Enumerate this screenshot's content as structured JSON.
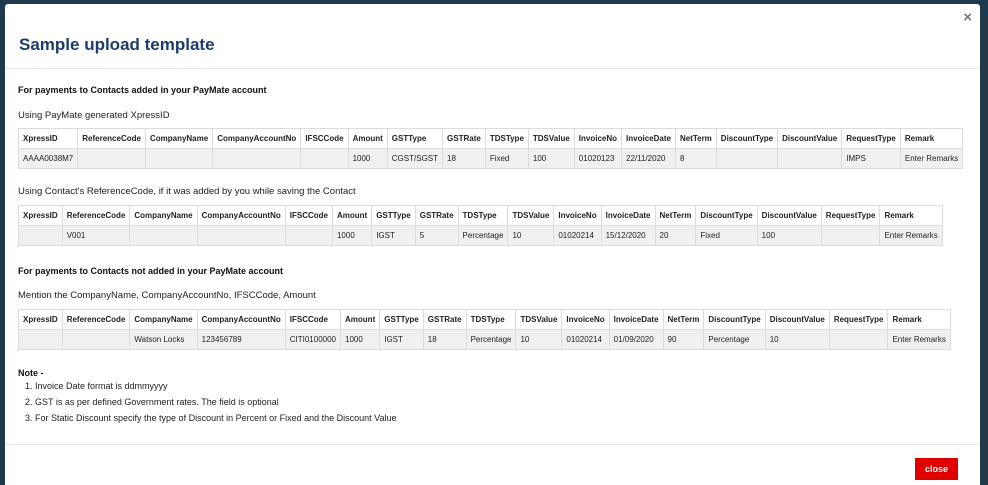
{
  "modal": {
    "title": "Sample upload template",
    "close_icon": "×",
    "close_button": "close"
  },
  "section1": {
    "title": "For payments to Contacts added in your PayMate account",
    "subtitle": "Using PayMate generated XpressID",
    "headers": [
      "XpressID",
      "ReferenceCode",
      "CompanyName",
      "CompanyAccountNo",
      "IFSCCode",
      "Amount",
      "GSTType",
      "GSTRate",
      "TDSType",
      "TDSValue",
      "InvoiceNo",
      "InvoiceDate",
      "NetTerm",
      "DiscountType",
      "DiscountValue",
      "RequestType",
      "Remark"
    ],
    "row": [
      "AAAA0038M7",
      "",
      "",
      "",
      "",
      "1000",
      "CGST/SGST",
      "18",
      "Fixed",
      "100",
      "01020123",
      "22/11/2020",
      "8",
      "",
      "",
      "IMPS",
      "Enter Remarks"
    ]
  },
  "section2": {
    "subtitle": "Using Contact's ReferenceCode, if it was added by you while saving the Contact",
    "headers": [
      "XpressID",
      "ReferenceCode",
      "CompanyName",
      "CompanyAccountNo",
      "IFSCCode",
      "Amount",
      "GSTType",
      "GSTRate",
      "TDSType",
      "TDSValue",
      "InvoiceNo",
      "InvoiceDate",
      "NetTerm",
      "DiscountType",
      "DiscountValue",
      "RequestType",
      "Remark"
    ],
    "row": [
      "",
      "V001",
      "",
      "",
      "",
      "1000",
      "IGST",
      "5",
      "Percentage",
      "10",
      "01020214",
      "15/12/2020",
      "20",
      "Fixed",
      "100",
      "",
      "Enter Remarks"
    ]
  },
  "section3": {
    "title": "For payments to Contacts not added in your PayMate account",
    "subtitle": "Mention the CompanyName, CompanyAccountNo, IFSCCode, Amount",
    "headers": [
      "XpressID",
      "ReferenceCode",
      "CompanyName",
      "CompanyAccountNo",
      "IFSCCode",
      "Amount",
      "GSTType",
      "GSTRate",
      "TDSType",
      "TDSValue",
      "InvoiceNo",
      "InvoiceDate",
      "NetTerm",
      "DiscountType",
      "DiscountValue",
      "RequestType",
      "Remark"
    ],
    "row": [
      "",
      "",
      "Watson Locks",
      "123456789",
      "CITI0100000",
      "1000",
      "IGST",
      "18",
      "Percentage",
      "10",
      "01020214",
      "01/09/2020",
      "90",
      "Percentage",
      "10",
      "",
      "Enter Remarks"
    ]
  },
  "notes": {
    "title": "Note -",
    "items": [
      "Invoice Date format is ddmmyyyy",
      "GST is as per defined Government rates. The field is optional",
      "For Static Discount specify the type of Discount in Percent or Fixed and the Discount Value"
    ]
  }
}
